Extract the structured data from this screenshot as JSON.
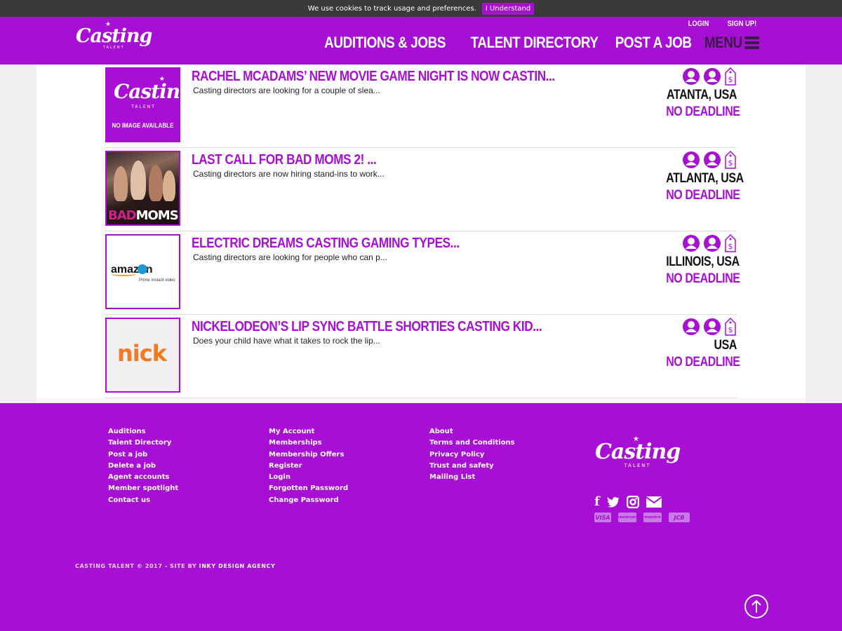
{
  "cookie": {
    "message": "We use cookies to track usage and preferences.",
    "button": "I Understand"
  },
  "header": {
    "logo": {
      "word": "Casting",
      "sub": "TALENT"
    },
    "top_links": {
      "login": "LOGIN",
      "signup": "SIGN UP!"
    },
    "nav": {
      "auditions": "AUDITIONS & JOBS",
      "directory": "TALENT DIRECTORY",
      "post": "POST A JOB",
      "menu": "MENU"
    }
  },
  "listings": [
    {
      "title": "RACHEL MCADAMS’ NEW MOVIE GAME NIGHT IS NOW CASTIN...",
      "description": "Casting directors are looking for a couple of slea...",
      "location": "ATANTA, USA",
      "deadline": "NO DEADLINE",
      "thumb": {
        "type": "placeholder",
        "logo_word": "Casting",
        "logo_sub": "TALENT",
        "caption": "NO IMAGE AVAILABLE"
      }
    },
    {
      "title": "LAST CALL FOR BAD MOMS 2! ...",
      "description": "Casting directors are now hiring stand-ins to work...",
      "location": "ATLANTA, USA",
      "deadline": "NO DEADLINE",
      "thumb": {
        "type": "poster",
        "word1": "BAD",
        "word2": "MOMS"
      }
    },
    {
      "title": "ELECTRIC DREAMS CASTING GAMING TYPES...",
      "description": "Casting directors are looking for people who can p...",
      "location": "ILLINOIS, USA",
      "deadline": "NO DEADLINE",
      "thumb": {
        "type": "logo",
        "brand": "amazon",
        "line2": "Prime",
        "line2b": "instant video"
      }
    },
    {
      "title": "NICKELODEON’S LIP SYNC BATTLE SHORTIES CASTING KID...",
      "description": "Does your child have what it takes to rock the lip...",
      "location": "USA",
      "deadline": "NO DEADLINE",
      "thumb": {
        "type": "logo",
        "brand": "nick"
      }
    }
  ],
  "listing_icons": [
    "user-icon",
    "user-icon",
    "price-tag-icon"
  ],
  "footer": {
    "col1": [
      "Auditions",
      "Talent Directory",
      "Post a job",
      "Delete a job",
      "Agent accounts",
      "Member spotlight",
      "Contact us"
    ],
    "col2": [
      "My Account",
      "Memberships",
      "Membership Offers",
      "Register",
      "Login",
      "Forgotten Password",
      "Change Password"
    ],
    "col3": [
      "About",
      "Terms and Conditions",
      "Privacy Policy",
      "Trust and safety",
      "Mailing List"
    ],
    "logo": {
      "word": "Casting",
      "sub": "TALENT"
    },
    "social": [
      "facebook-icon",
      "twitter-icon",
      "instagram-icon",
      "email-icon"
    ],
    "cards": [
      "VISA",
      "mastercard",
      "maestro",
      "JCB"
    ],
    "copyright": "CASTING TALENT © 2017 - SITE BY",
    "agency": "INKY DESIGN AGENCY"
  },
  "colors": {
    "brand": "#a80fd4",
    "header_menu": "#3a1a48",
    "cookie_bar": "#3a3a3a"
  }
}
